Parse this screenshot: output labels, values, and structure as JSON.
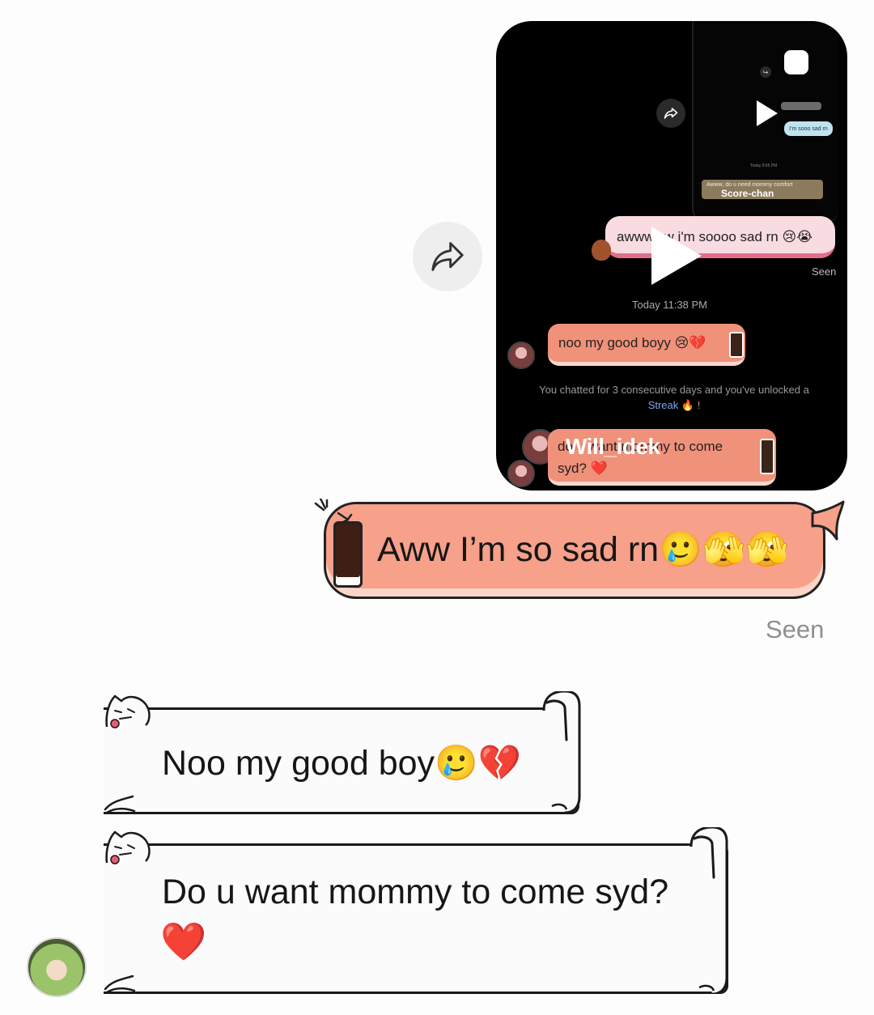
{
  "shared_reel": {
    "mini_preview": {
      "bubble_text": "I'm sooo sad rn",
      "time": "Today 8:55 PM",
      "banner_text": "Awww, do u need mommy comfort",
      "username": "Score-chan"
    },
    "sent_preview": "awwwww i'm soooo sad rn 😢😭",
    "seen": "Seen",
    "timestamp": "Today 11:38 PM",
    "reply_1": "noo my good boyy 😢💔",
    "streak_prefix": "You chatted for 3 consecutive days and you've unlocked a",
    "streak_word": "Streak",
    "streak_suffix": "🔥 !",
    "reply_2_line1": "do u want mommy to come",
    "reply_2_line2": "syd? ❤️",
    "username": "Will_idek"
  },
  "sent_message": {
    "text": "Aww I’m so sad rn",
    "emojis": "🥲🫣🫣"
  },
  "seen_label": "Seen",
  "received_messages": [
    {
      "text": "Noo my good boy",
      "emojis": "🥲💔"
    },
    {
      "text": "Do u want mommy to come syd?",
      "emojis": "❤️"
    }
  ],
  "colors": {
    "sent_bubble": "#f7a08a",
    "reel_background": "#000000",
    "seen_text": "#8f8f8f",
    "streak_link": "#7ea8e6"
  },
  "icons": [
    "share-icon",
    "play-icon",
    "reel-icon",
    "soda-can-icon",
    "cat-sticker-icon"
  ]
}
